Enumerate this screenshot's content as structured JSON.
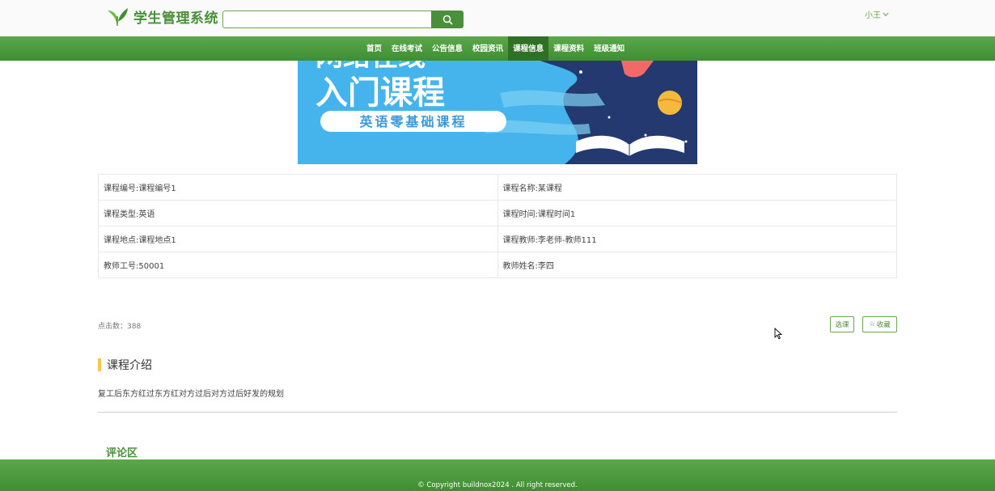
{
  "header": {
    "logo_text": "学生管理系统",
    "search_placeholder": "",
    "search_icon": "search-icon",
    "user_name": "小王",
    "user_chevron_icon": "chevron-down-icon"
  },
  "nav": {
    "items": [
      "首页",
      "在线考试",
      "公告信息",
      "校园资讯",
      "课程信息",
      "课程资料",
      "班级通知"
    ],
    "active_index": 4
  },
  "banner": {
    "line1": "网络在线",
    "line2": "入门课程",
    "subtitle": "英语零基础课程"
  },
  "course": {
    "rows": [
      [
        "课程编号:课程编号1",
        "课程名称:某课程"
      ],
      [
        "课程类型:英语",
        "课程时间:课程时间1"
      ],
      [
        "课程地点:课程地点1",
        "课程教师:李老师-教师111"
      ],
      [
        "教师工号:50001",
        "教师姓名:李四"
      ]
    ]
  },
  "stats": {
    "clicks": "点击数：388"
  },
  "actions": {
    "select_label": "选课",
    "favorite_icon": "star-outline-icon",
    "favorite_label": "收藏"
  },
  "intro": {
    "title": "课程介绍",
    "text": "复工后东方红过东方红对方过后对方过后好发的规划"
  },
  "comments": {
    "title": "评论区"
  },
  "footer": {
    "copyright": "© Copyright buildnox2024 . All right reserved."
  },
  "colors": {
    "primary": "#4a8f3a",
    "nav_active": "#2f7026",
    "accent_bar": "#f2c94c",
    "banner_bg": "#3fb0e8"
  }
}
